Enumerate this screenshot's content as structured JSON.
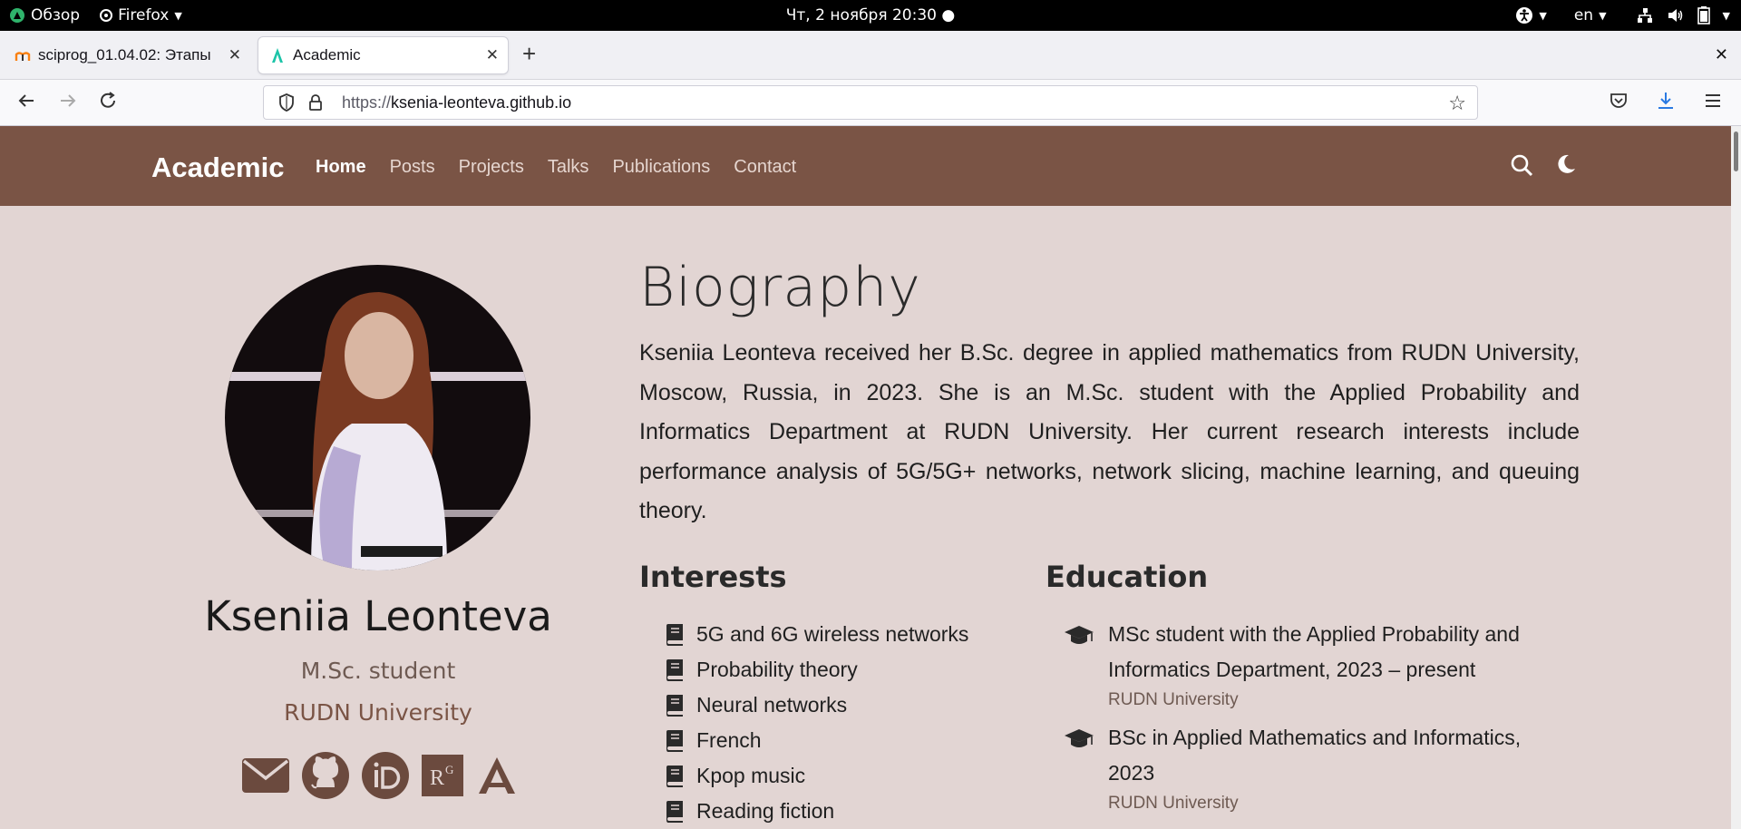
{
  "system_bar": {
    "overview": "Обзор",
    "app": "Firefox",
    "datetime": "Чт, 2 ноября  20:30",
    "language": "en"
  },
  "tabs": [
    {
      "title": "sciprog_01.04.02: Этапы",
      "active": false
    },
    {
      "title": "Academic",
      "active": true
    }
  ],
  "url": {
    "prefix": "https://",
    "host": "ksenia-leonteva.github.io"
  },
  "site": {
    "brand": "Academic",
    "menu": [
      "Home",
      "Posts",
      "Projects",
      "Talks",
      "Publications",
      "Contact"
    ],
    "active_menu": "Home",
    "header_color": "#7a5445"
  },
  "profile": {
    "name": "Kseniia Leonteva",
    "role": "M.Sc. student",
    "organization": "RUDN University",
    "social_icons": [
      "envelope-icon",
      "github-icon",
      "orcid-icon",
      "researchgate-icon",
      "academia-icon"
    ]
  },
  "biography": {
    "title": "Biography",
    "text": "Kseniia Leonteva received her B.Sc. degree in applied mathematics from RUDN University, Moscow, Russia, in 2023. She is an M.Sc. student with the Applied Probability and Informatics Department at RUDN University. Her current research interests include performance analysis of 5G/5G+ networks, network slicing, machine learning, and queuing theory."
  },
  "interests": {
    "title": "Interests",
    "items": [
      "5G and 6G wireless networks",
      "Probability theory",
      "Neural networks",
      "French",
      "Kpop music",
      "Reading fiction"
    ]
  },
  "education": {
    "title": "Education",
    "items": [
      {
        "course": "MSc student with the Applied Probability and Informatics Department, 2023 – present",
        "institution": "RUDN University"
      },
      {
        "course": "BSc in Applied Mathematics and Informatics, 2023",
        "institution": "RUDN University"
      }
    ]
  }
}
